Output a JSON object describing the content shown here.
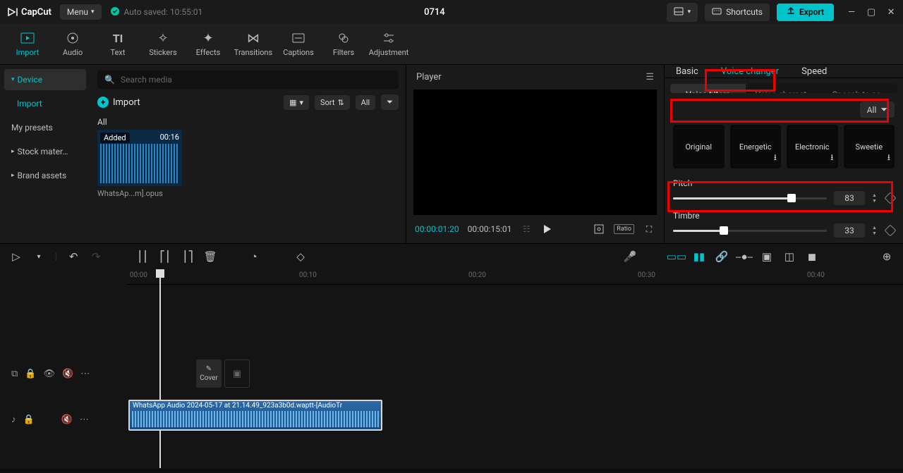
{
  "app": {
    "name": "CapCut"
  },
  "menu": {
    "label": "Menu"
  },
  "autosave": {
    "text": "Auto saved: 10:55:01"
  },
  "document": {
    "title": "0714"
  },
  "top": {
    "shortcuts": "Shortcuts",
    "export": "Export"
  },
  "tools": [
    {
      "label": "Import"
    },
    {
      "label": "Audio"
    },
    {
      "label": "Text"
    },
    {
      "label": "Stickers"
    },
    {
      "label": "Effects"
    },
    {
      "label": "Transitions"
    },
    {
      "label": "Captions"
    },
    {
      "label": "Filters"
    },
    {
      "label": "Adjustment"
    }
  ],
  "side": {
    "device": "Device",
    "import": "Import",
    "my_presets": "My presets",
    "stock": "Stock mater…",
    "brand": "Brand assets"
  },
  "media": {
    "search_placeholder": "Search media",
    "import_label": "Import",
    "sort": "Sort",
    "all": "All",
    "section": "All",
    "clip": {
      "badge": "Added",
      "duration": "00:16",
      "name": "WhatsAp...m].opus"
    }
  },
  "player": {
    "title": "Player",
    "current": "00:00:01:20",
    "total": "00:00:15:01",
    "ratio": "Ratio"
  },
  "right": {
    "tabs": {
      "basic": "Basic",
      "voice": "Voice changer",
      "speed": "Speed"
    },
    "subtabs": {
      "filters": "Voice filters",
      "characters": "Voice charact…",
      "tts": "Speech to so…"
    },
    "all": "All",
    "presets": [
      "Original",
      "Energetic",
      "Electronic",
      "Sweetie"
    ],
    "pitch": {
      "label": "Pitch",
      "value": "83",
      "percent": 77
    },
    "timbre": {
      "label": "Timbre",
      "value": "33",
      "percent": 33
    }
  },
  "timeline": {
    "ticks": [
      "00:00",
      "00:10",
      "00:20",
      "00:30",
      "00:40"
    ],
    "cover": "Cover",
    "clip_name": "WhatsApp Audio 2024-05-17 at 21.14.49_923a3b0d.waptt-[AudioTr"
  }
}
